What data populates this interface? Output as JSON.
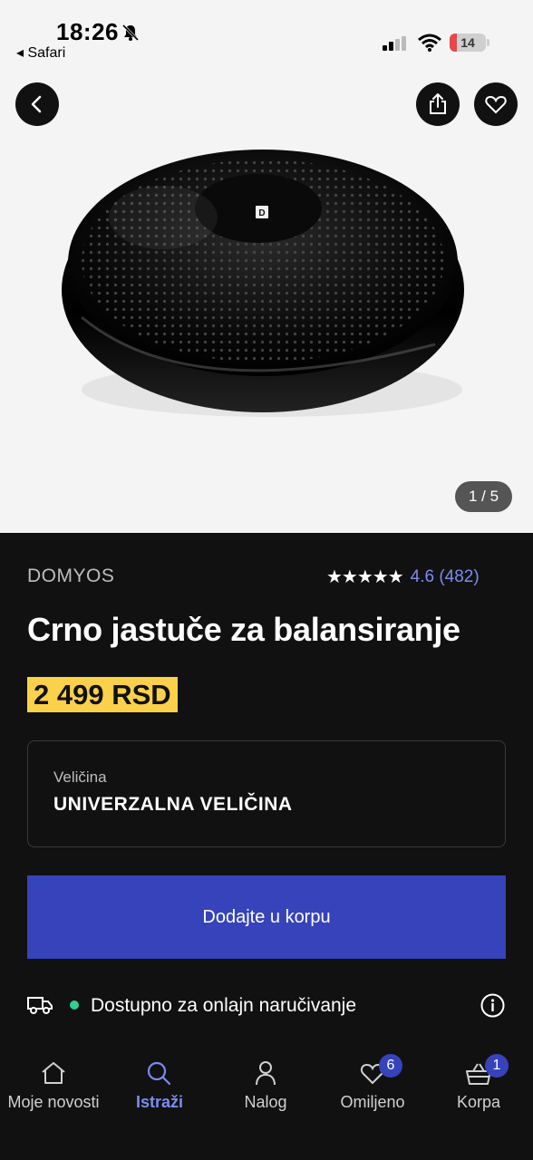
{
  "status_bar": {
    "time": "18:26",
    "back_app": "◂ Safari",
    "battery": "14"
  },
  "gallery": {
    "counter": "1 / 5",
    "product_logo": "D"
  },
  "product": {
    "brand": "DOMYOS",
    "rating_stars": "★★★★★",
    "rating_value": "4.6 (482)",
    "title": "Crno jastuče za balansiranje",
    "price": "2 499 RSD",
    "size_label": "Veličina",
    "size_value": "UNIVERZALNA VELIČINA",
    "add_to_cart": "Dodajte u korpu",
    "availability": "Dostupno za onlajn naručivanje"
  },
  "tabbar": {
    "items": [
      {
        "label": "Moje novosti",
        "icon": "home-icon"
      },
      {
        "label": "Istraži",
        "icon": "search-icon"
      },
      {
        "label": "Nalog",
        "icon": "user-icon"
      },
      {
        "label": "Omiljeno",
        "icon": "heart-icon",
        "badge": "6"
      },
      {
        "label": "Korpa",
        "icon": "basket-icon",
        "badge": "1"
      }
    ],
    "active_index": 1
  },
  "colors": {
    "accent": "#3643ba",
    "link": "#7b8cf0",
    "price_bg": "#fbd14b",
    "available": "#2fcf8f"
  }
}
